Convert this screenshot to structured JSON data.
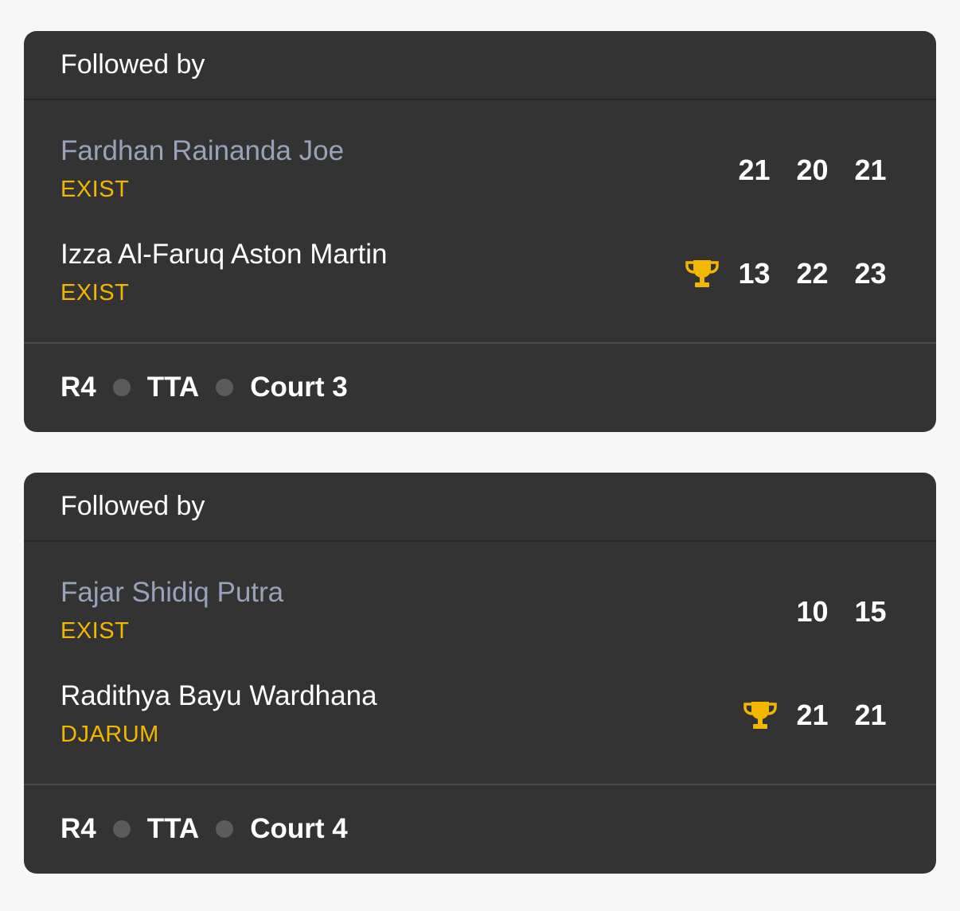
{
  "matches": [
    {
      "header": "Followed by",
      "players": [
        {
          "name": "Fardhan Rainanda Joe",
          "club": "EXIST",
          "winner": false,
          "scores": [
            "21",
            "20",
            "21"
          ]
        },
        {
          "name": "Izza Al-Faruq Aston Martin",
          "club": "EXIST",
          "winner": true,
          "scores": [
            "13",
            "22",
            "23"
          ]
        }
      ],
      "footer": {
        "round": "R4",
        "venue": "TTA",
        "court": "Court 3"
      }
    },
    {
      "header": "Followed by",
      "players": [
        {
          "name": "Fajar Shidiq Putra",
          "club": "EXIST",
          "winner": false,
          "scores": [
            "10",
            "15"
          ]
        },
        {
          "name": "Radithya Bayu Wardhana",
          "club": "DJARUM",
          "winner": true,
          "scores": [
            "21",
            "21"
          ]
        }
      ],
      "footer": {
        "round": "R4",
        "venue": "TTA",
        "court": "Court 4"
      }
    }
  ],
  "icons": {
    "winner": "trophy-icon",
    "separator": "dot-separator"
  },
  "colors": {
    "card_bg": "#333333",
    "club": "#f2b700",
    "trophy": "#f2b700",
    "loser_name": "#98a2b8",
    "winner_name": "#ffffff"
  }
}
